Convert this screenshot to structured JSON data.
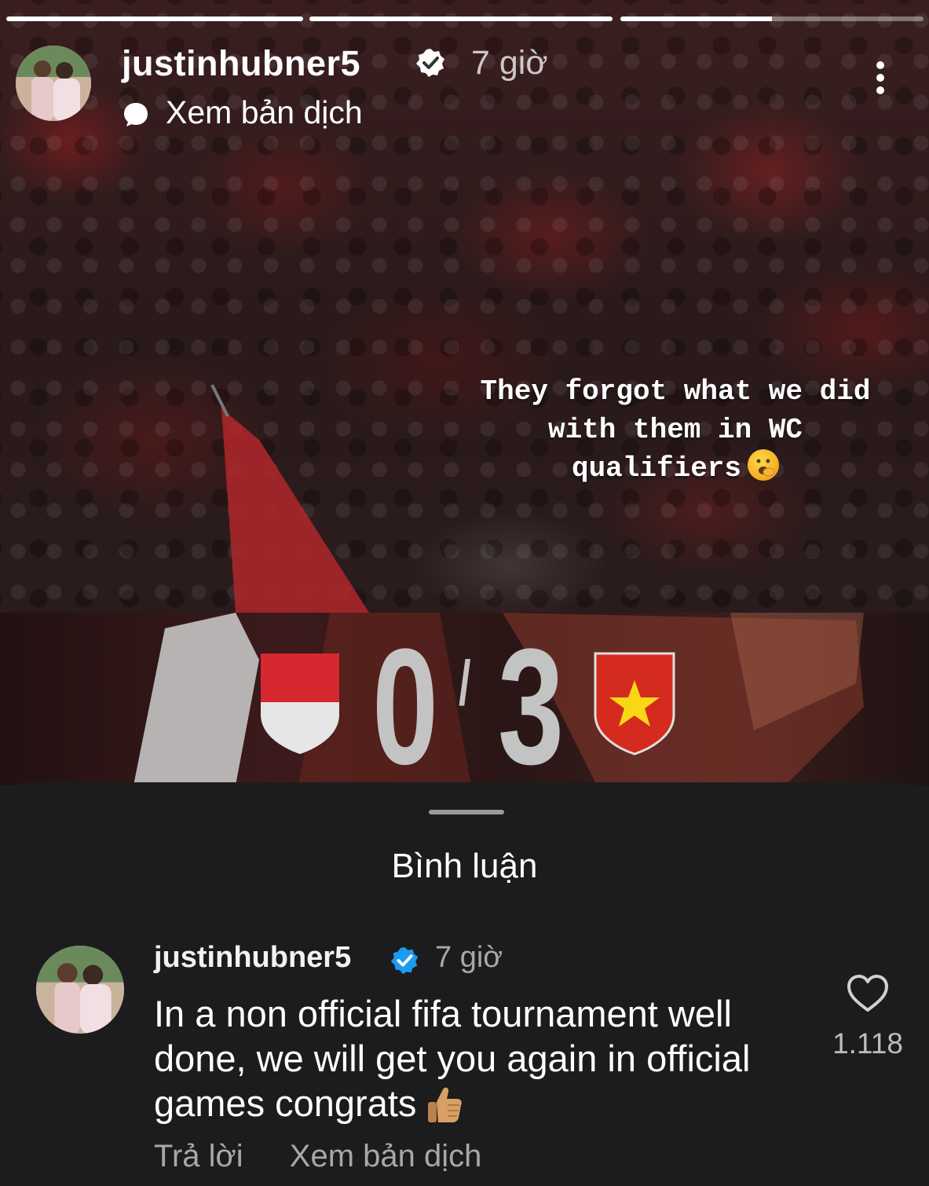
{
  "story": {
    "progress": [
      1.0,
      1.0,
      0.5
    ],
    "username": "justinhubner5",
    "verified": true,
    "time": "7 giờ",
    "translate_label": "Xem bản dịch",
    "caption": "They forgot what we did with them in WC qualifiers",
    "caption_emoji": "yawning-face-emoji",
    "score": {
      "home": "0",
      "away": "3",
      "separator": "/"
    },
    "badges": {
      "home": "indonesia-shield",
      "away": "vietnam-shield"
    }
  },
  "comments_sheet": {
    "title": "Bình luận",
    "comment": {
      "username": "justinhubner5",
      "verified": true,
      "time": "7 giờ",
      "text": "In a non official fifa tournament well done, we will get you again in official games  congrats",
      "emoji": "thumbs-up-emoji",
      "like_count": "1.118",
      "reply_label": "Trả lời",
      "translate_label": "Xem bản dịch"
    }
  },
  "colors": {
    "verified_story": "#ffffff",
    "verified_comment": "#1d9bf0",
    "sheet_bg": "#1c1c1e",
    "indonesia_red": "#d7282f",
    "vietnam_red": "#d52b1e",
    "vietnam_star": "#f8d816"
  },
  "icons": [
    "more-vertical-icon",
    "speech-bubble-icon",
    "verified-badge-icon",
    "heart-icon"
  ]
}
